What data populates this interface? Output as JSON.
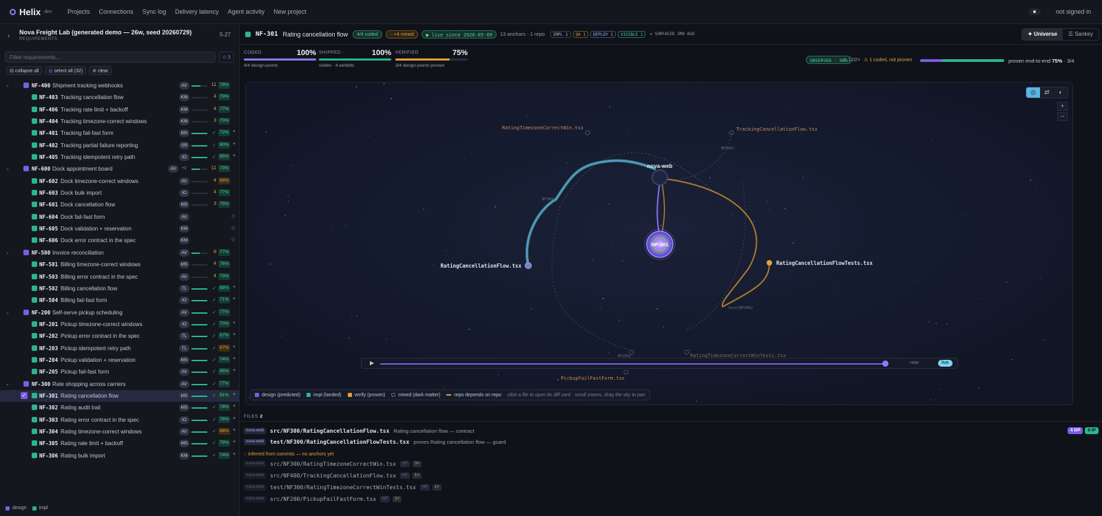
{
  "app": {
    "name": "Helix",
    "env": "dev"
  },
  "nav": [
    "Projects",
    "Connections",
    "Sync log",
    "Delivery latency",
    "Agent activity",
    "New project"
  ],
  "auth": {
    "status": "not signed in"
  },
  "sidebar": {
    "title": "Nova Freight Lab (generated demo — 26w, seed 20260729)",
    "subtitle": "REQUIREMENTS",
    "range": "5-27",
    "filter_placeholder": "Filter requirements...",
    "filter_count": "◇ 3",
    "buttons": [
      "collapse all",
      "select all (32)",
      "clear"
    ],
    "legend": [
      "design",
      "impl"
    ],
    "rows": [
      {
        "kind": "group",
        "id": "NF-400",
        "name": "Shipment tracking webhooks",
        "av": "AV",
        "num": "11",
        "pct": "79%",
        "bar": 0.55
      },
      {
        "kind": "child",
        "id": "NF-403",
        "name": "Tracking cancellation flow",
        "av": "KM",
        "num": "4",
        "pct": "79%"
      },
      {
        "kind": "child",
        "id": "NF-406",
        "name": "Tracking rate limit + backoff",
        "av": "KM",
        "num": "4",
        "pct": "77%"
      },
      {
        "kind": "child",
        "id": "NF-404",
        "name": "Tracking timezone-correct windows",
        "av": "KM",
        "num": "3",
        "pct": "70%"
      },
      {
        "kind": "child",
        "id": "NF-401",
        "name": "Tracking fail-fast form",
        "av": "MS",
        "num": "✓",
        "pct": "72%",
        "bar": 1,
        "tail": "+"
      },
      {
        "kind": "child",
        "id": "NF-402",
        "name": "Tracking partial failure reporting",
        "av": "SR",
        "num": "✓",
        "pct": "80%",
        "bar": 1,
        "tail": "+"
      },
      {
        "kind": "child",
        "id": "NF-405",
        "name": "Tracking idempotent retry path",
        "av": "IO",
        "num": "✓",
        "pct": "85%",
        "bar": 1,
        "tail": "+"
      },
      {
        "kind": "group",
        "id": "NF-600",
        "name": "Dock appointment board",
        "av": "AV",
        "extra": "+3",
        "num": "11",
        "pct": "73%",
        "bar": 0.5
      },
      {
        "kind": "child",
        "id": "NF-602",
        "name": "Dock timezone-correct windows",
        "av": "AV",
        "num": "4",
        "pct": "66%",
        "warn": true
      },
      {
        "kind": "child",
        "id": "NF-603",
        "name": "Dock bulk import",
        "av": "IO",
        "num": "4",
        "pct": "77%"
      },
      {
        "kind": "child",
        "id": "NF-601",
        "name": "Dock cancellation flow",
        "av": "MS",
        "num": "3",
        "pct": "75%"
      },
      {
        "kind": "child",
        "id": "NF-604",
        "name": "Dock fail-fast form",
        "av": "AV",
        "tail": "◇",
        "vt": true
      },
      {
        "kind": "child",
        "id": "NF-605",
        "name": "Dock validation + reservation",
        "av": "KM",
        "tail": "◇",
        "vt": true
      },
      {
        "kind": "child",
        "id": "NF-606",
        "name": "Dock error contract in the spec",
        "av": "KM",
        "tail": "◇",
        "vt": true
      },
      {
        "kind": "group",
        "id": "NF-500",
        "name": "Invoice reconciliation",
        "av": "AV",
        "num": "8",
        "pct": "77%",
        "bar": 0.5
      },
      {
        "kind": "child",
        "id": "NF-501",
        "name": "Billing timezone-correct windows",
        "av": "MS",
        "num": "4",
        "pct": "76%"
      },
      {
        "kind": "child",
        "id": "NF-503",
        "name": "Billing error contract in the spec",
        "av": "AV",
        "num": "4",
        "pct": "73%"
      },
      {
        "kind": "child",
        "id": "NF-502",
        "name": "Billing cancellation flow",
        "av": "TL",
        "num": "✓",
        "pct": "88%",
        "bar": 1,
        "tail": "+"
      },
      {
        "kind": "child",
        "id": "NF-504",
        "name": "Billing fail-fast form",
        "av": "IO",
        "num": "✓",
        "pct": "71%",
        "bar": 1,
        "tail": "+"
      },
      {
        "kind": "group",
        "id": "NF-200",
        "name": "Self-serve pickup scheduling",
        "av": "AV",
        "num": "✓",
        "pct": "77%",
        "bar": 1
      },
      {
        "kind": "child",
        "id": "NF-201",
        "name": "Pickup timezone-correct windows",
        "av": "IO",
        "num": "✓",
        "pct": "70%",
        "bar": 1,
        "tail": "+"
      },
      {
        "kind": "child",
        "id": "NF-202",
        "name": "Pickup error contract in the spec",
        "av": "TL",
        "num": "✓",
        "pct": "87%",
        "bar": 1,
        "tail": "+"
      },
      {
        "kind": "child",
        "id": "NF-203",
        "name": "Pickup idempotent retry path",
        "av": "TL",
        "num": "✓",
        "pct": "67%",
        "bar": 1,
        "tail": "+",
        "warn": true
      },
      {
        "kind": "child",
        "id": "NF-204",
        "name": "Pickup validation + reservation",
        "av": "MS",
        "num": "✓",
        "pct": "74%",
        "bar": 1,
        "tail": "+"
      },
      {
        "kind": "child",
        "id": "NF-205",
        "name": "Pickup fail-fast form",
        "av": "AV",
        "num": "✓",
        "pct": "85%",
        "bar": 1,
        "tail": "+"
      },
      {
        "kind": "group",
        "id": "NF-300",
        "name": "Rate shopping across carriers",
        "av": "AV",
        "num": "✓",
        "pct": "77%",
        "bar": 1
      },
      {
        "kind": "child",
        "id": "NF-301",
        "name": "Rating cancellation flow",
        "av": "MS",
        "num": "✓",
        "pct": "81%",
        "bar": 1,
        "tail": "+",
        "selected": true
      },
      {
        "kind": "child",
        "id": "NF-302",
        "name": "Rating audit trail",
        "av": "MS",
        "num": "✓",
        "pct": "76%",
        "bar": 1,
        "tail": "+"
      },
      {
        "kind": "child",
        "id": "NF-303",
        "name": "Rating error contract in the spec",
        "av": "IO",
        "num": "✓",
        "pct": "78%",
        "bar": 1,
        "tail": "+"
      },
      {
        "kind": "child",
        "id": "NF-304",
        "name": "Rating timezone-correct windows",
        "av": "AV",
        "num": "✓",
        "pct": "68%",
        "bar": 1,
        "tail": "+",
        "warn": true
      },
      {
        "kind": "child",
        "id": "NF-305",
        "name": "Rating rate limit + backoff",
        "av": "MS",
        "num": "✓",
        "pct": "79%",
        "bar": 1,
        "tail": "+"
      },
      {
        "kind": "child",
        "id": "NF-306",
        "name": "Rating bulk import",
        "av": "KM",
        "num": "✓",
        "pct": "74%",
        "bar": 1,
        "tail": "+"
      }
    ]
  },
  "detail": {
    "id": "NF-301",
    "name": "Rating cancellation flow",
    "coded": "4/4 coded",
    "mined": "◌ +4 mined",
    "live": "● live since 2026-05-09",
    "meta": "13 anchors · 1 repo",
    "tags": [
      "IMPL 1",
      "QA 1",
      "DEPLOY 1",
      "VISIBLE 1",
      "◇ SURFACED 3MO AGO"
    ],
    "views": [
      "✦ Universe",
      "☰ Sankey"
    ],
    "metrics": [
      {
        "label": "CODED",
        "value": "100%",
        "sub": "4/4 design-points",
        "fill": 1,
        "color": "#8b7cf6"
      },
      {
        "label": "SHIPPED ·",
        "value": "100%",
        "sub": "visible · 4 exhibits",
        "fill": 1,
        "color": "#2bb58e"
      },
      {
        "label": "VERIFIED",
        "value": "75%",
        "sub": "3/4 design-points proven",
        "fill": 0.75,
        "color": "#e0a23b"
      }
    ],
    "observed": "OBSERVED · 98%",
    "observed_x": "◇ 1.02×",
    "observed_warn": "⚠ 1 coded, not proven",
    "e2e": {
      "label": "proven end-to-end",
      "pct": "75%",
      "frac": "· 3/4",
      "design_share": 0.26
    }
  },
  "graph": {
    "hub": "nova-web",
    "node": "NF-301",
    "files": [
      "RatingCancellationFlow.tsx",
      "RatingCancellationFlowTests.tsx",
      "RatingTimezoneCorrectWin.tsx",
      "TrackingCancellationFlow.tsx",
      "RatingTimezoneCorrectWinTests.tsx",
      "PickupFailFastForm.tsx"
    ],
    "edge_labels": [
      "NF300/",
      "NF400/",
      "test/NF300/",
      "NF200/"
    ],
    "controls": [
      "◎",
      "⇄",
      "◐"
    ],
    "zoom": [
      "+",
      "−"
    ],
    "timeline": {
      "play": "▶",
      "now": "now",
      "live": "live",
      "position": 0.995
    },
    "legend": [
      {
        "label": "design (predicted)",
        "color": "#7c5ce6"
      },
      {
        "label": "impl (landed)",
        "color": "#2bb58e"
      },
      {
        "label": "verify (proven)",
        "color": "#e0a23b"
      },
      {
        "label": "mined (dark matter)",
        "color": "dashed"
      },
      {
        "label": "repo depends on repo",
        "color": "#e0a23b"
      }
    ],
    "hint": "click a file to open its diff card · scroll zooms, drag the sky to pan"
  },
  "files": {
    "label": "FILES",
    "count": "2",
    "anchored": [
      {
        "repo": "nova-web",
        "path": "src/NF300/RatingCancellationFlow.tsx",
        "desc": "Rating cancellation flow — contract"
      },
      {
        "repo": "nova-web",
        "path": "test/NF300/RatingCancellationFlowTests.tsx",
        "desc": "proves Rating cancellation flow — guard"
      }
    ],
    "badges": [
      {
        "text": "4 DP",
        "color": "#7c5ce6"
      },
      {
        "text": "6 IP",
        "color": "#2bb58e"
      }
    ],
    "inferred": "◌ inferred from commits — no anchors yet",
    "mined": [
      {
        "repo": "nova-web",
        "path": "src/NF300/RatingTimezoneCorrectWin.tsx",
        "tag": "NF",
        "count": "3×"
      },
      {
        "repo": "nova-web",
        "path": "src/NF400/TrackingCancellationFlow.tsx",
        "tag": "NF",
        "count": "1×"
      },
      {
        "repo": "nova-web",
        "path": "test/NF300/RatingTimezoneCorrectWinTests.tsx",
        "tag": "NF",
        "count": "1×"
      },
      {
        "repo": "nova-web",
        "path": "src/NF200/PickupFailFastForm.tsx",
        "tag": "NF",
        "count": "1×"
      }
    ]
  }
}
